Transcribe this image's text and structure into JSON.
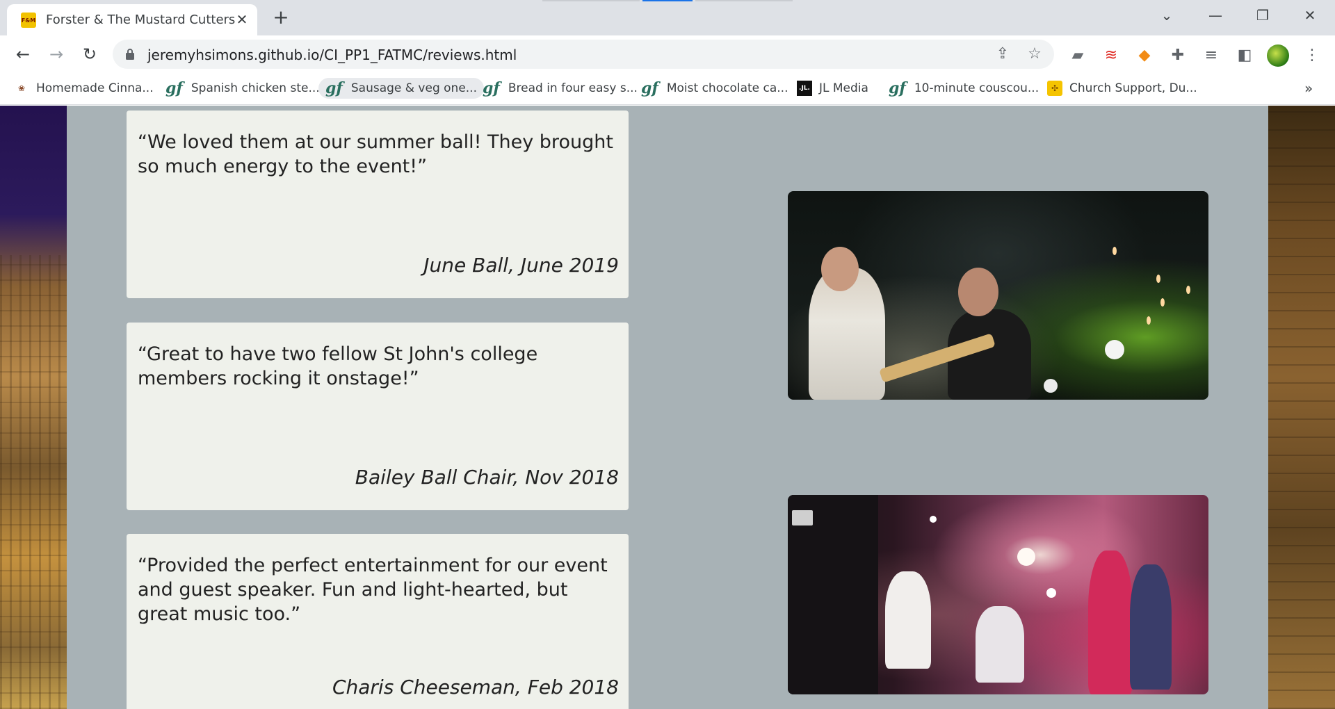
{
  "browser": {
    "tab": {
      "title": "Forster & The Mustard Cutters",
      "favicon_text": "F&M"
    },
    "url": "jeremyhsimons.github.io/CI_PP1_FATMC/reviews.html",
    "bookmarks": [
      {
        "label": "Homemade Cinna...",
        "icon": "cinnamon-icon"
      },
      {
        "label": "Spanish chicken ste...",
        "icon": "gf-icon"
      },
      {
        "label": "Sausage & veg one...",
        "icon": "gf-icon"
      },
      {
        "label": "Bread in four easy s...",
        "icon": "gf-icon"
      },
      {
        "label": "Moist chocolate ca...",
        "icon": "gf-icon"
      },
      {
        "label": "JL Media",
        "icon": "jl-icon"
      },
      {
        "label": "10-minute couscou...",
        "icon": "gf-icon"
      },
      {
        "label": "Church Support, Du...",
        "icon": "church-icon"
      }
    ],
    "gf_icon_text": "gf",
    "jl_icon_text": ".JL.",
    "more_bookmarks": "»"
  },
  "reviews": [
    {
      "quote": "“We loved them at our summer ball! They brought so much energy to the event!”",
      "source": "June Ball, June 2019"
    },
    {
      "quote": "“Great to have two fellow St John's college members rocking it onstage!”",
      "source": "Bailey Ball Chair, Nov 2018"
    },
    {
      "quote": "“Provided the perfect entertainment for our event and guest speaker. Fun and light-hearted, but great music too.”",
      "source": "Charis Cheeseman, Feb 2018"
    }
  ],
  "photos": [
    {
      "alt": "band-performing-photo-1"
    },
    {
      "alt": "band-performing-photo-2"
    }
  ],
  "colors": {
    "content_bg": "#a8b2b6",
    "card_bg": "#eff1eb",
    "accent_loading": "#1a73e8"
  }
}
